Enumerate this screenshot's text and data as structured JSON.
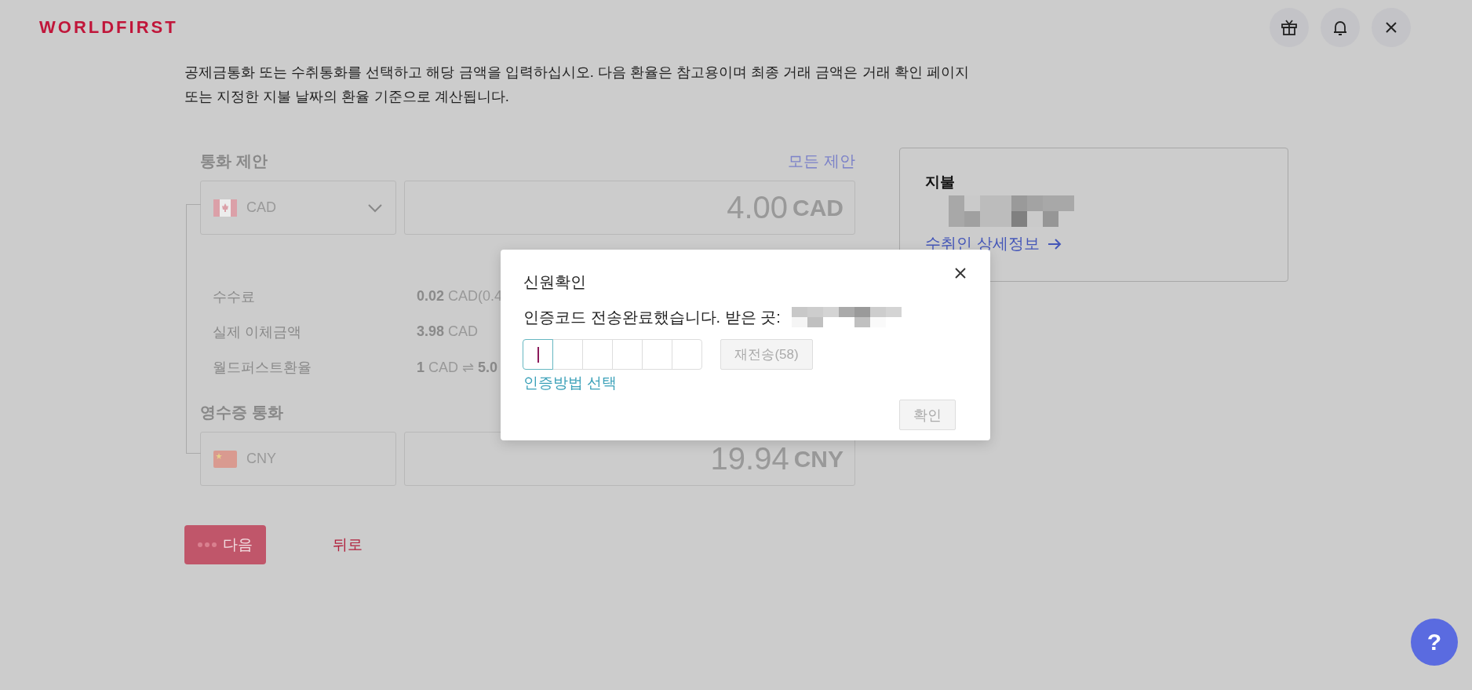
{
  "header": {
    "logo": "WORLDFIRST"
  },
  "intro": "공제금통화 또는 수취통화를 선택하고 해당 금액을 입력하십시오. 다음 환율은 참고용이며 최종 거래 금액은 거래 확인 페이지\n또는 지정한 지불 날짜의 환율 기준으로 계산됩니다.",
  "send": {
    "label": "통화 제안",
    "all_link": "모든 제안",
    "currency": "CAD",
    "amount": "4.00",
    "amount_currency": "CAD"
  },
  "fees": [
    {
      "label": "수수료",
      "value": "**0.02** CAD(0.4"
    },
    {
      "label": "실제 이체금액",
      "value": "**3.98** CAD"
    },
    {
      "label": "월드퍼스트환율",
      "value": "**1** CAD ⇌ **5.0**"
    }
  ],
  "receive": {
    "label": "영수증 통화",
    "currency": "CNY",
    "amount": "19.94",
    "amount_currency": "CNY"
  },
  "buttons": {
    "next": "다음",
    "next_loading": true,
    "back": "뒤로"
  },
  "payment_card": {
    "title": "지불",
    "link": "수취인 상세정보"
  },
  "modal": {
    "title": "신원확인",
    "message": "인증코드 전송완료했습니다. 받은 곳:",
    "code_boxes": [
      {
        "selected": true
      },
      {
        "selected": false
      },
      {
        "selected": false
      },
      {
        "selected": false
      },
      {
        "selected": false
      },
      {
        "selected": false
      }
    ],
    "resend": "재전송(58)",
    "resend_disabled": true,
    "method_link": "인증방법 선택",
    "confirm": "확인",
    "confirm_disabled": true
  },
  "help": "?"
}
